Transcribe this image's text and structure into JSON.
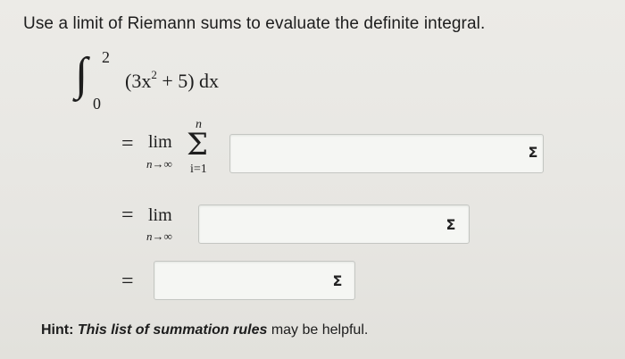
{
  "question": {
    "title": "Use a limit of Riemann sums to evaluate the definite integral."
  },
  "integral": {
    "sign": "∫",
    "upper": "2",
    "lower": "0",
    "integrand_pre": "(3x",
    "exponent": "2",
    "integrand_post": " + 5)  dx"
  },
  "steps": [
    {
      "equals": "=",
      "lim": "lim",
      "lim_sub": "n→∞",
      "sigma_upper": "n",
      "sigma_symbol": "Σ",
      "sigma_lower": "i=1",
      "input_value": "",
      "sigma_button": "Σ"
    },
    {
      "equals": "=",
      "lim": "lim",
      "lim_sub": "n→∞",
      "input_value": "",
      "sigma_button": "Σ"
    },
    {
      "equals": "=",
      "input_value": "",
      "sigma_button": "Σ"
    }
  ],
  "hint": {
    "label": "Hint:",
    "link_text": "This list of summation rules",
    "suffix": " may be helpful."
  }
}
